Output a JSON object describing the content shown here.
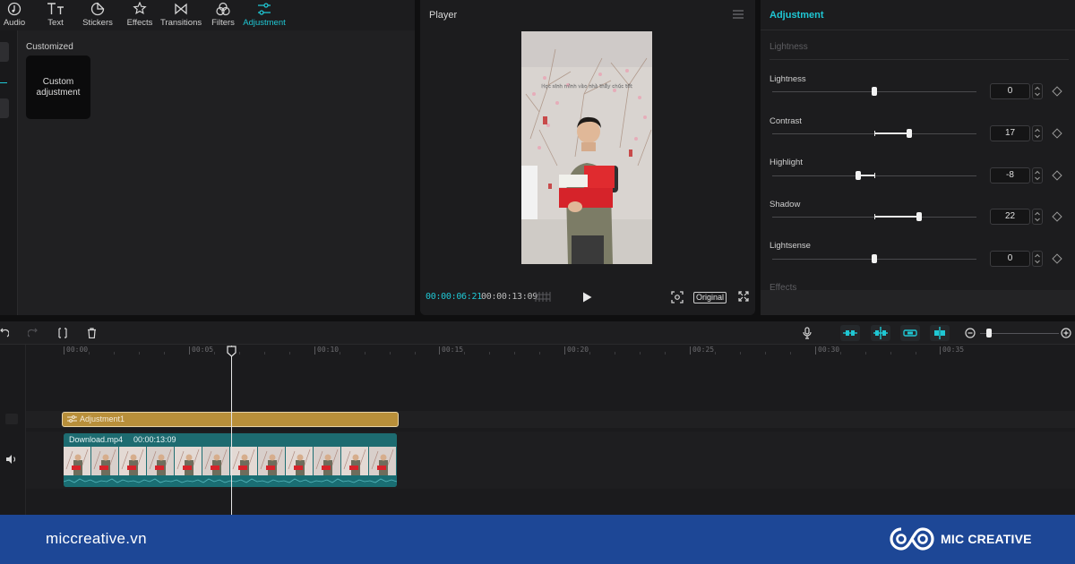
{
  "toolbar": {
    "tabs": [
      {
        "label": "Audio",
        "icon": "audio-icon"
      },
      {
        "label": "Text",
        "icon": "text-icon"
      },
      {
        "label": "Stickers",
        "icon": "stickers-icon"
      },
      {
        "label": "Effects",
        "icon": "effects-icon"
      },
      {
        "label": "Transitions",
        "icon": "transitions-icon"
      },
      {
        "label": "Filters",
        "icon": "filters-icon"
      },
      {
        "label": "Adjustment",
        "icon": "adjustment-icon",
        "active": true
      }
    ]
  },
  "library": {
    "section": "Customized",
    "card_label": "Custom adjustment"
  },
  "player": {
    "title": "Player",
    "video_caption": "Học sinh mình vào nhà thầy chúc tết",
    "current_time": "00:00:06:21",
    "total_time": "00:00:13:09",
    "original_label": "Original"
  },
  "adjustment": {
    "title": "Adjustment",
    "section": "Lightness",
    "next_section": "Effects",
    "rows": [
      {
        "label": "Lightness",
        "value": "0"
      },
      {
        "label": "Contrast",
        "value": "17"
      },
      {
        "label": "Highlight",
        "value": "-8"
      },
      {
        "label": "Shadow",
        "value": "22"
      },
      {
        "label": "Lightsense",
        "value": "0"
      }
    ]
  },
  "timeline": {
    "ruler": [
      "00:00",
      "00:05",
      "00:10",
      "00:15",
      "00:20",
      "00:25",
      "00:30",
      "00:35"
    ],
    "adjustment_clip": "Adjustment1",
    "video_clip": {
      "name": "Download.mp4",
      "duration": "00:00:13:09"
    }
  },
  "footer": {
    "url": "miccreative.vn",
    "brand": "MIC CREATIVE"
  },
  "colors": {
    "accent": "#1fc7d4",
    "adjustment_clip": "#b88f3a",
    "video_clip": "#1e6e72",
    "footer": "#1d4796"
  }
}
